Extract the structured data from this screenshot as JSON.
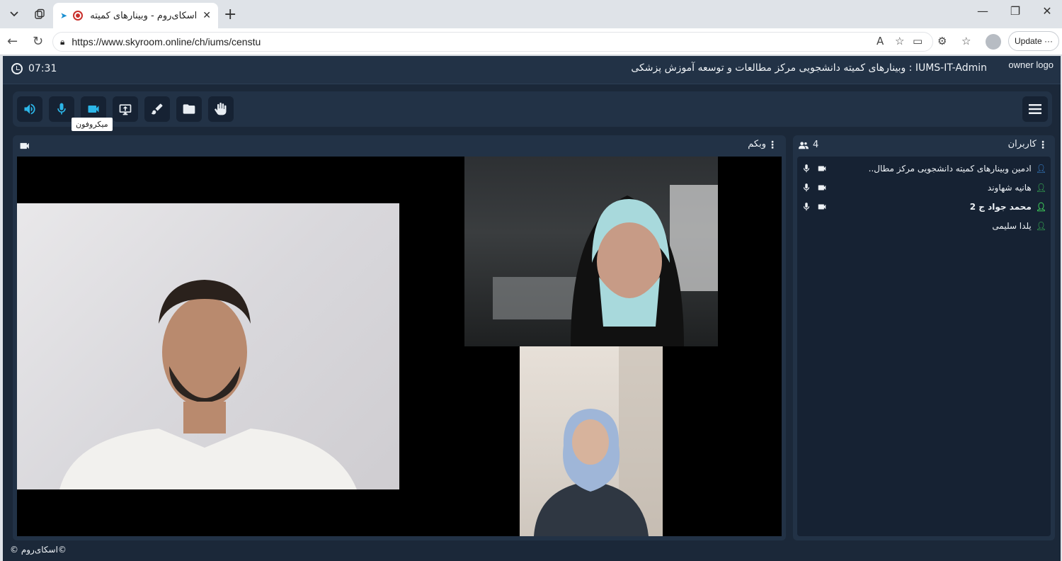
{
  "browser": {
    "tab_title": "اسکای‌روم - وبینارهای کمیته دانشجویی",
    "url": "https://www.skyroom.online/ch/iums/censtu",
    "update_label": "Update"
  },
  "app": {
    "clock_time": "07:31",
    "room_title": "IUMS-IT-Admin : وبینارهای کمیته دانشجویی مرکز مطالعات و توسعه آموزش پزشکی",
    "owner_logo_alt": "owner logo",
    "toolbar": {
      "tooltip": "میکروفون",
      "tools": [
        "speaker-icon",
        "microphone-icon",
        "camera-icon",
        "screen-share-icon",
        "whiteboard-icon",
        "files-icon",
        "raise-hand-icon"
      ]
    },
    "webcam_panel": {
      "title": "وبکم"
    },
    "users_panel": {
      "title": "کاربران",
      "count": "4",
      "users": [
        {
          "name": "ادمین وبینارهای کمیته دانشجویی مرکز مطال..",
          "role": "admin",
          "icon_color": "#3b8de0",
          "has_media": true
        },
        {
          "name": "هانیه شهاوند",
          "role": "user",
          "icon_color": "#3ecf5a",
          "has_media": true
        },
        {
          "name": "محمد جواد ج 2",
          "role": "user",
          "icon_color": "#3ecf5a",
          "has_media": true
        },
        {
          "name": "یلدا سلیمی",
          "role": "user",
          "icon_color": "#3ecf5a",
          "has_media": false
        }
      ]
    },
    "footer": "©اسکای‌روم ©"
  }
}
